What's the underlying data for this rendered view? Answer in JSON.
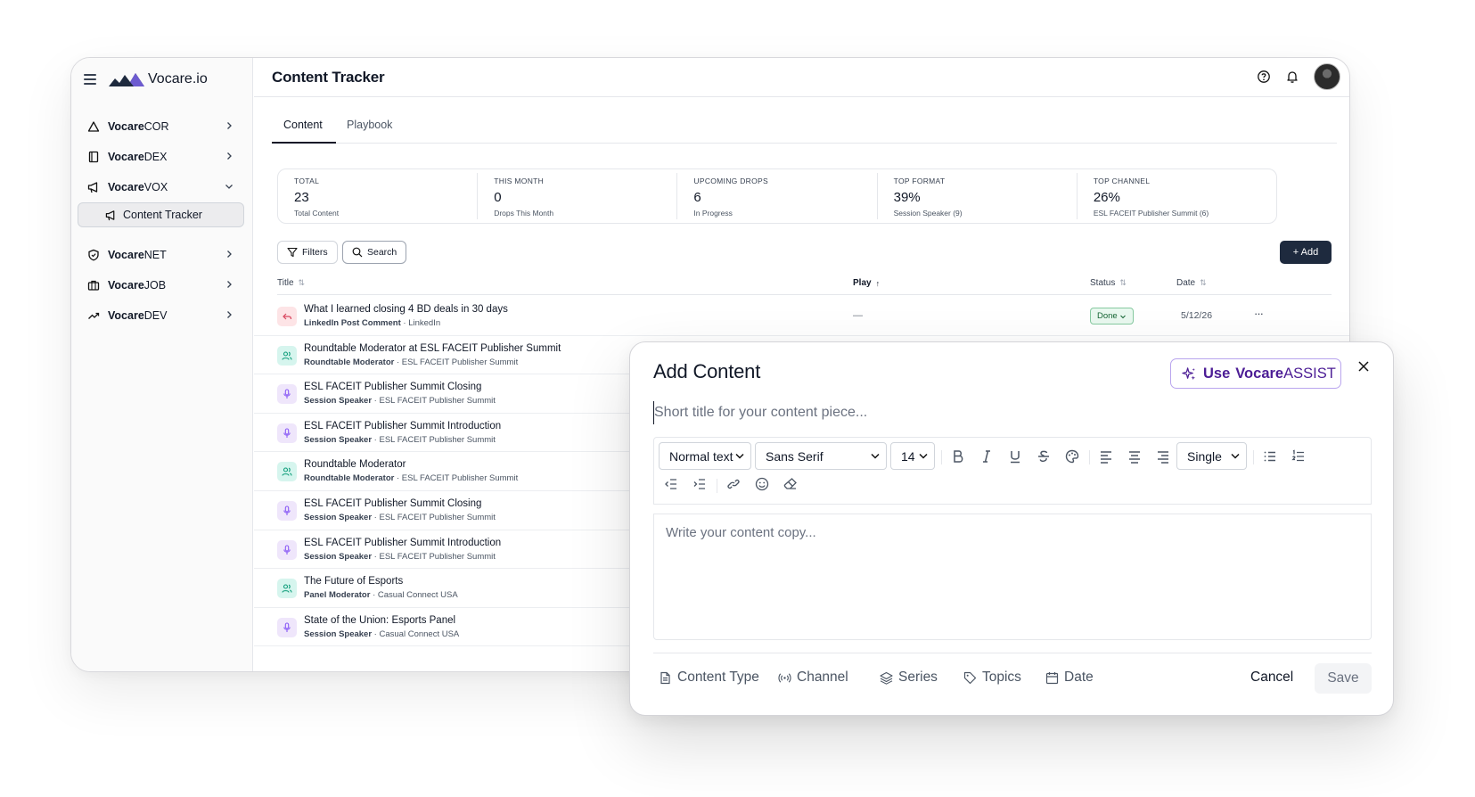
{
  "brand": {
    "name": "Vocare.io"
  },
  "sidebar": {
    "items": [
      {
        "bold": "Vocare",
        "rest": "COR",
        "icon": "triangle-icon"
      },
      {
        "bold": "Vocare",
        "rest": "DEX",
        "icon": "book-icon"
      },
      {
        "bold": "Vocare",
        "rest": "VOX",
        "icon": "megaphone-icon"
      },
      {
        "bold": "Vocare",
        "rest": "NET",
        "icon": "shield-icon"
      },
      {
        "bold": "Vocare",
        "rest": "JOB",
        "icon": "briefcase-icon"
      },
      {
        "bold": "Vocare",
        "rest": "DEV",
        "icon": "trending-up-icon"
      }
    ],
    "sub_item": "Content Tracker"
  },
  "header": {
    "title": "Content Tracker"
  },
  "tabs": [
    {
      "label": "Content"
    },
    {
      "label": "Playbook"
    }
  ],
  "stats": [
    {
      "label": "TOTAL",
      "value": "23",
      "sub": "Total Content"
    },
    {
      "label": "THIS MONTH",
      "value": "0",
      "sub": "Drops This Month"
    },
    {
      "label": "UPCOMING DROPS",
      "value": "6",
      "sub": "In Progress"
    },
    {
      "label": "TOP FORMAT",
      "value": "39%",
      "sub": "Session Speaker (9)"
    },
    {
      "label": "TOP CHANNEL",
      "value": "26%",
      "sub": "ESL FACEIT Publisher Summit (6)"
    }
  ],
  "toolbar": {
    "filters": "Filters",
    "search": "Search",
    "add": "+ Add"
  },
  "table": {
    "columns": {
      "title": "Title",
      "play": "Play",
      "status": "Status",
      "date": "Date"
    },
    "sort_glyph": "⇅",
    "sort_up_glyph": "↑",
    "rows": [
      {
        "title": "What I learned closing 4 BD deals in 30 days",
        "type": "LinkedIn Post Comment",
        "channel": "LinkedIn",
        "badge": "pink",
        "play": "—",
        "status": "Done",
        "date": "5/12/26",
        "more": "···"
      },
      {
        "title": "Roundtable Moderator at ESL FACEIT Publisher Summit",
        "type": "Roundtable Moderator",
        "channel": "ESL FACEIT Publisher Summit",
        "badge": "teal"
      },
      {
        "title": "ESL FACEIT Publisher Summit Closing",
        "type": "Session Speaker",
        "channel": "ESL FACEIT Publisher Summit",
        "badge": "lav"
      },
      {
        "title": "ESL FACEIT Publisher Summit Introduction",
        "type": "Session Speaker",
        "channel": "ESL FACEIT Publisher Summit",
        "badge": "lav"
      },
      {
        "title": "Roundtable Moderator",
        "type": "Roundtable Moderator",
        "channel": "ESL FACEIT Publisher Summit",
        "badge": "teal"
      },
      {
        "title": "ESL FACEIT Publisher Summit Closing",
        "type": "Session Speaker",
        "channel": "ESL FACEIT Publisher Summit",
        "badge": "lav"
      },
      {
        "title": "ESL FACEIT Publisher Summit Introduction",
        "type": "Session Speaker",
        "channel": "ESL FACEIT Publisher Summit",
        "badge": "lav"
      },
      {
        "title": "The Future of Esports",
        "type": "Panel Moderator",
        "channel": "Casual Connect USA",
        "badge": "teal"
      },
      {
        "title": "State of the Union: Esports Panel",
        "type": "Session Speaker",
        "channel": "Casual Connect USA",
        "badge": "lav"
      }
    ]
  },
  "modal": {
    "title": "Add Content",
    "assist": {
      "use": "Use",
      "brand_bold": "Vocare",
      "brand_rest": "ASSIST"
    },
    "title_placeholder": "Short title for your content piece...",
    "body_placeholder": "Write your content copy...",
    "toolbar": {
      "text_style": "Normal text",
      "font": "Sans Serif",
      "size": "14",
      "line_spacing": "Single"
    },
    "meta": [
      {
        "label": "Content Type",
        "icon": "file-icon"
      },
      {
        "label": "Channel",
        "icon": "broadcast-icon"
      },
      {
        "label": "Series",
        "icon": "layers-icon"
      },
      {
        "label": "Topics",
        "icon": "tag-icon"
      },
      {
        "label": "Date",
        "icon": "calendar-icon"
      }
    ],
    "cancel": "Cancel",
    "save": "Save"
  },
  "colors": {
    "accent": "#1e2a3e",
    "assist": "#4c1d95",
    "done_bg": "#e9f8ef",
    "done_text": "#166534"
  }
}
